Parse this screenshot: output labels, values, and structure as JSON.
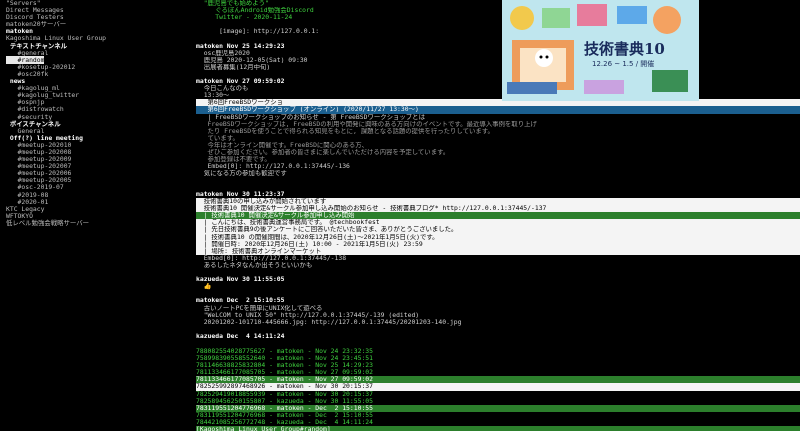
{
  "sidebar": {
    "items": [
      {
        "text": "\"Servers\"",
        "style": "dim"
      },
      {
        "text": "Direct Messages",
        "style": "dim"
      },
      {
        "text": "Discord Testers",
        "style": "dim"
      },
      {
        "text": "matoken20サーバー",
        "style": "dim"
      },
      {
        "text": "matoken",
        "style": "bold"
      },
      {
        "text": "Kagoshima Linux User Group",
        "style": "dim"
      },
      {
        "text": " テキストチャンネル",
        "style": "bold"
      },
      {
        "text": "   #general",
        "style": "dim"
      },
      {
        "text": "   #random",
        "style": "sel"
      },
      {
        "text": "   #kosetup-202012",
        "style": "dim"
      },
      {
        "text": "   #osc20fk",
        "style": "dim"
      },
      {
        "text": " news",
        "style": "bold"
      },
      {
        "text": "   #kagolug_ml",
        "style": "dim"
      },
      {
        "text": "   #kagolug_twitter",
        "style": "dim"
      },
      {
        "text": "   #ospnjp",
        "style": "dim"
      },
      {
        "text": "   #distrowatch",
        "style": "dim"
      },
      {
        "text": "   #security",
        "style": "dim"
      },
      {
        "text": " ボイスチャンネル",
        "style": "bold"
      },
      {
        "text": "   General",
        "style": "dim"
      },
      {
        "text": " Off(?) line meeting",
        "style": "bold"
      },
      {
        "text": "   #meetup-202010",
        "style": "dim"
      },
      {
        "text": "   #meetup-202008",
        "style": "dim"
      },
      {
        "text": "   #meetup-202009",
        "style": "dim"
      },
      {
        "text": "   #meetup-202007",
        "style": "dim"
      },
      {
        "text": "   #meetup-202006",
        "style": "dim"
      },
      {
        "text": "   #meetup-202005",
        "style": "dim"
      },
      {
        "text": "   #osc-2019-07",
        "style": "dim"
      },
      {
        "text": "   #2019-08",
        "style": "dim"
      },
      {
        "text": "   #2020-01",
        "style": "dim"
      },
      {
        "text": "KTC Legacy",
        "style": "dim"
      },
      {
        "text": "WFTOKYO",
        "style": "dim"
      },
      {
        "text": "低レベル勉強会戦略サーバー",
        "style": "dim"
      }
    ]
  },
  "main": {
    "top_lines": [
      {
        "text": "  \"鹿児島でも始めよう\"",
        "style": "green"
      },
      {
        "text": "     ぐるぼんAndroid勉強会Discord",
        "style": "green"
      },
      {
        "text": "     Twitter - 2020-11-24",
        "style": "green"
      },
      {
        "text": "",
        "style": ""
      },
      {
        "text": "      [image]: http://127.0.0.1:",
        "style": ""
      },
      {
        "text": "",
        "style": ""
      },
      {
        "text": "matoken Nov 25 14:29:23",
        "style": "bold"
      },
      {
        "text": "  osc鹿児島2020 ",
        "style": ""
      },
      {
        "text": "  鹿児島 2020-12-05(Sat) 09:30",
        "style": ""
      },
      {
        "text": "  出展者募集(12月中旬)",
        "style": ""
      },
      {
        "text": "",
        "style": ""
      },
      {
        "text": "matoken Nov 27 09:59:02",
        "style": "bold"
      },
      {
        "text": "  今日こんなのも",
        "style": ""
      },
      {
        "text": "  13:30〜",
        "style": ""
      },
      {
        "text": "   第6回FreeBSDワークショ",
        "style": "hlw"
      },
      {
        "text": "   第6回FreeBSDワークショップ (オンライン) (2020/11/27 13:30〜)",
        "style": "hlb"
      },
      {
        "text": "   | FreeBSDワークショップのお知らせ - 第 FreeBSDワークショップとは",
        "style": ""
      },
      {
        "text": "   FreeBSDワークショップは, FreeBSDの利用や開発に興味のある方向けのイベントです。最近導入事例を取り上げ",
        "style": "gray"
      },
      {
        "text": "   たり FreeBSDを使うことで得られる知見をもとに, 課題となる話題の提供を行ったりしています。",
        "style": "gray"
      },
      {
        "text": "   ています。",
        "style": "gray"
      },
      {
        "text": "   今年はオンライン開催です。FreeBSDに関心のある方、",
        "style": "gray"
      },
      {
        "text": "   ぜひご参加ください。参加者の皆さまに楽しんでいただける内容を予定しています。",
        "style": "gray"
      },
      {
        "text": "   参加登録は不要です。",
        "style": "gray"
      },
      {
        "text": "   Embed[0]: http://127.0.0.1:37445/-136",
        "style": ""
      },
      {
        "text": "  気になる方の参加も歓迎です",
        "style": ""
      }
    ],
    "mid_lines": [
      {
        "text": "matoken Nov 30 11:23:37",
        "style": "bold"
      },
      {
        "text": "  技術書典10の申し込みが開始されています",
        "style": "hlw"
      },
      {
        "text": "  技術書典10 開催決定&サークル参加申し込み開始のお知らせ - 技術書典ブログ* http://127.0.0.1:37445/-137",
        "style": "hlw"
      },
      {
        "text": "  | 技術書典10 開催決定&サークル参加申し込み開始",
        "style": "hlg"
      },
      {
        "text": "  | こんにちは、技術書典運営事務局です。 @techbookfest",
        "style": "hlw"
      },
      {
        "text": "  | 先日技術書典9の後アンケートにご回答いただいた皆さま、ありがとうございました。",
        "style": "hlw"
      },
      {
        "text": "  | 技術書典10 の開催期間は、2020年12月26日(土)〜2021年1月5日(火)です。",
        "style": "hlw"
      },
      {
        "text": "  | 開催日時: 2020年12月26日(土) 10:00 - 2021年1月5日(火) 23:59",
        "style": "hlw"
      },
      {
        "text": "  | 場所: 技術書典オンラインマーケット",
        "style": "hlw"
      },
      {
        "text": "  Embed[0]: http://127.0.0.1:37445/-138",
        "style": ""
      },
      {
        "text": "  あるしたネタなんか出そうといいかも",
        "style": ""
      },
      {
        "text": "",
        "style": ""
      },
      {
        "text": "kazueda Nov 30 11:55:05",
        "style": "bold"
      },
      {
        "text": "  👍",
        "style": ""
      },
      {
        "text": "",
        "style": ""
      },
      {
        "text": "matoken Dec  2 15:10:55",
        "style": "bold"
      },
      {
        "text": "  古いノートPCを簡単にUNIX化して遊べる",
        "style": ""
      },
      {
        "text": "  \"WeLCOM to UNIX 50\" http://127.0.0.1:37445/-139 (edited)",
        "style": ""
      },
      {
        "text": "  20201202-101710-445666.jpg: http://127.0.0.1:37445/20201203-140.jpg",
        "style": ""
      },
      {
        "text": "",
        "style": ""
      },
      {
        "text": "kazueda Dec  4 14:11:24",
        "style": "bold"
      },
      {
        "text": "",
        "style": ""
      }
    ],
    "ids": [
      {
        "text": "788082554028775627 - matoken - Nov 24 23:32:35",
        "style": "green"
      },
      {
        "text": "758998390558552640 - matoken - Nov 24 23:45:51",
        "style": "green"
      },
      {
        "text": "781146638825832804 - matoken - Nov 25 14:29:23",
        "style": "green"
      },
      {
        "text": "781133466177085705 - matoken - Nov 27 09:59:02",
        "style": "green"
      },
      {
        "text": "781133466177085705 - matoken - Nov 27 09:59:02",
        "style": "hlg"
      },
      {
        "text": "782525992897468926 - matoken - Nov 30 20:15:37",
        "style": "hlw"
      },
      {
        "text": "782529419018855939 - matoken - Nov 30 20:15:37",
        "style": "green"
      },
      {
        "text": "782589456250155807 - kazueda - Nov 30 11:55:05",
        "style": "green"
      },
      {
        "text": "783119551204776968 - matoken - Dec  2 15:10:55",
        "style": "hlg"
      },
      {
        "text": "783119551204776968 - matoken - Dec  2 15:10:55",
        "style": "green"
      },
      {
        "text": "784421085256772748 - kazueda - Dec  4 14:11:24",
        "style": "green"
      },
      {
        "text": "[Kagoshima Linux User Group#random] ",
        "style": "hlg"
      }
    ]
  },
  "image": {
    "title": "技術書典10",
    "dates": "12.26 ~ 1.5 / 開催",
    "colors": {
      "sky": "#b9e3ea",
      "book": "#d85a7a",
      "ink": "#1a2c5c"
    }
  }
}
